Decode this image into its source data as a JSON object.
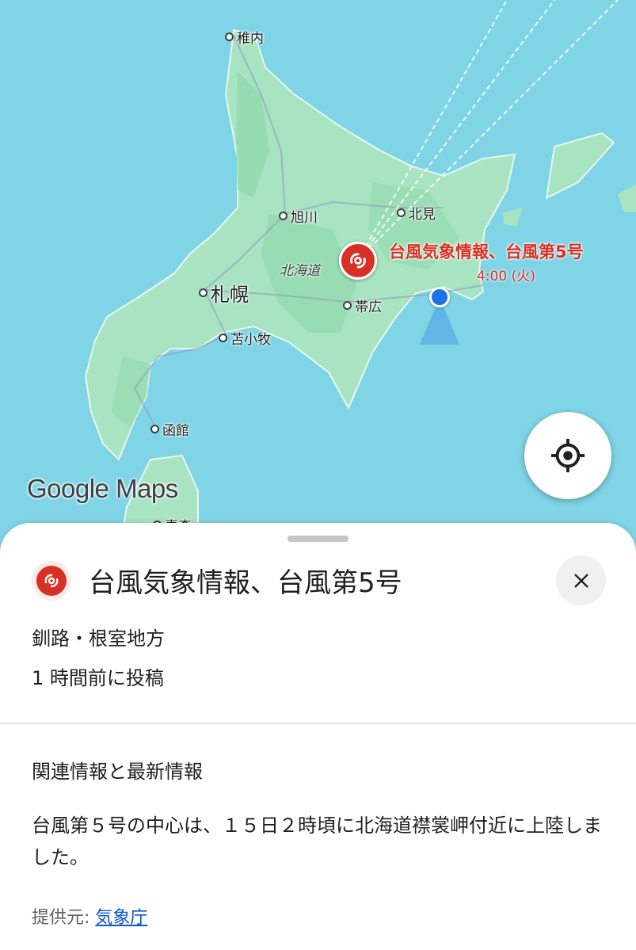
{
  "map": {
    "cities": [
      {
        "name": "稚内"
      },
      {
        "name": "旭川"
      },
      {
        "name": "北見"
      },
      {
        "name": "札幌"
      },
      {
        "name": "帯広"
      },
      {
        "name": "苫小牧"
      },
      {
        "name": "函館"
      },
      {
        "name": "青森"
      }
    ],
    "region_label": "北海道",
    "typhoon_label": {
      "title": "台風気象情報、台風第5号",
      "time": "4:00 (火)"
    },
    "logo": "Google Maps",
    "icons": {
      "locate": "my-location-icon",
      "typhoon": "typhoon-icon"
    },
    "colors": {
      "water": "#7fd4e6",
      "land": "#a8e4c1",
      "typhoon": "#d93025",
      "location": "#1a73e8"
    }
  },
  "sheet": {
    "title": "台風気象情報、台風第5号",
    "region": "釧路・根室地方",
    "posted": "1 時間前に投稿",
    "related_header": "関連情報と最新情報",
    "body": "台風第５号の中心は、１５日２時頃に北海道襟裳岬付近に上陸しました。",
    "source_label": "提供元:",
    "source_link": "気象庁",
    "close_icon": "close-icon"
  }
}
